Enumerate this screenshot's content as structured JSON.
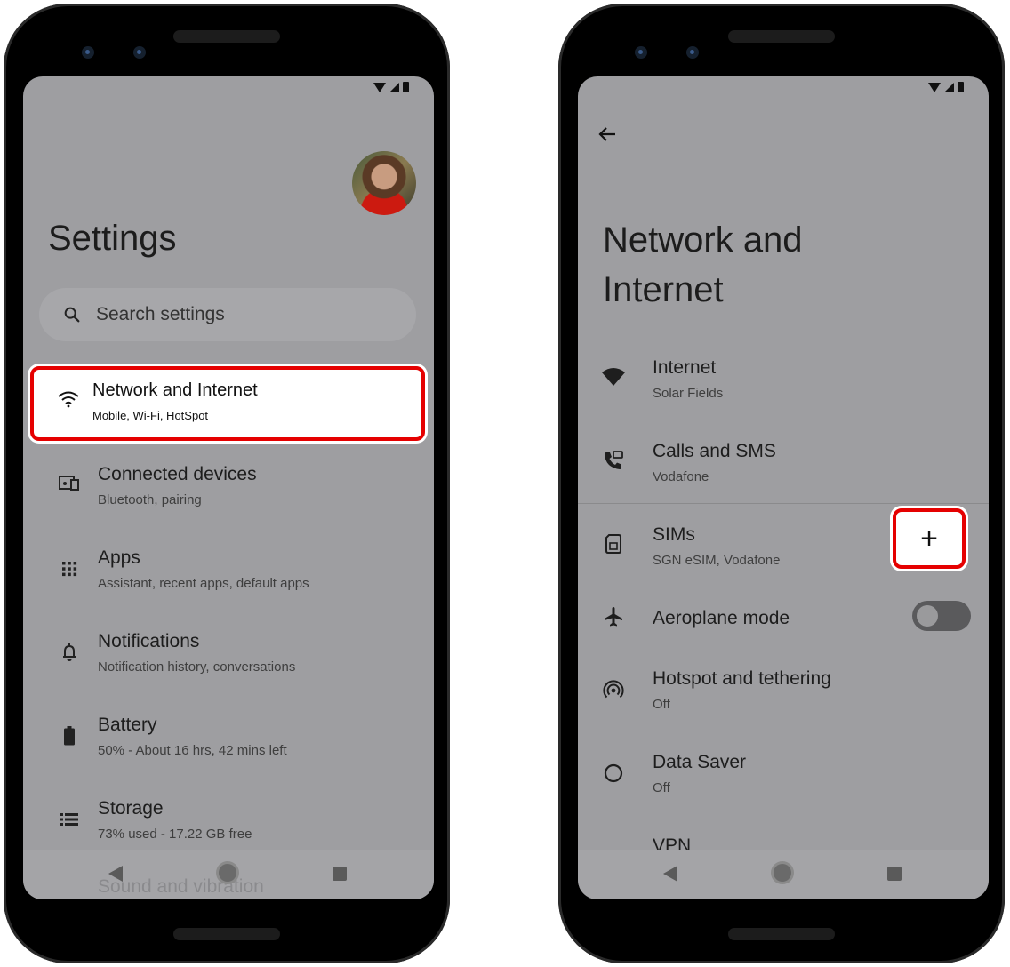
{
  "left_phone": {
    "title": "Settings",
    "search": {
      "placeholder": "Search settings"
    },
    "highlighted_item": {
      "label": "Network and Internet",
      "subtitle": "Mobile, Wi-Fi, HotSpot",
      "icon": "wifi-icon"
    },
    "items": [
      {
        "label": "Connected devices",
        "subtitle": "Bluetooth, pairing",
        "icon": "devices-icon"
      },
      {
        "label": "Apps",
        "subtitle": "Assistant, recent apps, default apps",
        "icon": "apps-grid-icon"
      },
      {
        "label": "Notifications",
        "subtitle": "Notification history, conversations",
        "icon": "bell-icon"
      },
      {
        "label": "Battery",
        "subtitle": "50% - About 16 hrs, 42 mins left",
        "icon": "battery-icon"
      },
      {
        "label": "Storage",
        "subtitle": "73% used - 17.22 GB free",
        "icon": "storage-icon"
      }
    ],
    "partial_item": "Sound and vibration"
  },
  "right_phone": {
    "title_line1": "Network and",
    "title_line2": "Internet",
    "items": [
      {
        "label": "Internet",
        "subtitle": "Solar Fields",
        "icon": "wifi-icon"
      },
      {
        "label": "Calls and SMS",
        "subtitle": "Vodafone",
        "icon": "phone-icon"
      },
      {
        "label": "SIMs",
        "subtitle": "SGN eSIM, Vodafone",
        "icon": "sim-icon"
      },
      {
        "label": "Aeroplane mode",
        "subtitle": "",
        "icon": "airplane-icon"
      },
      {
        "label": "Hotspot and tethering",
        "subtitle": "Off",
        "icon": "hotspot-icon"
      },
      {
        "label": "Data Saver",
        "subtitle": "Off",
        "icon": "data-saver-icon"
      },
      {
        "label": "VPN",
        "subtitle": "",
        "icon": "vpn-key-icon"
      }
    ],
    "add_button_label": "+",
    "aeroplane_mode_on": false
  },
  "colors": {
    "screen_bg": "#9e9ea1",
    "highlight_border": "#e50000"
  }
}
